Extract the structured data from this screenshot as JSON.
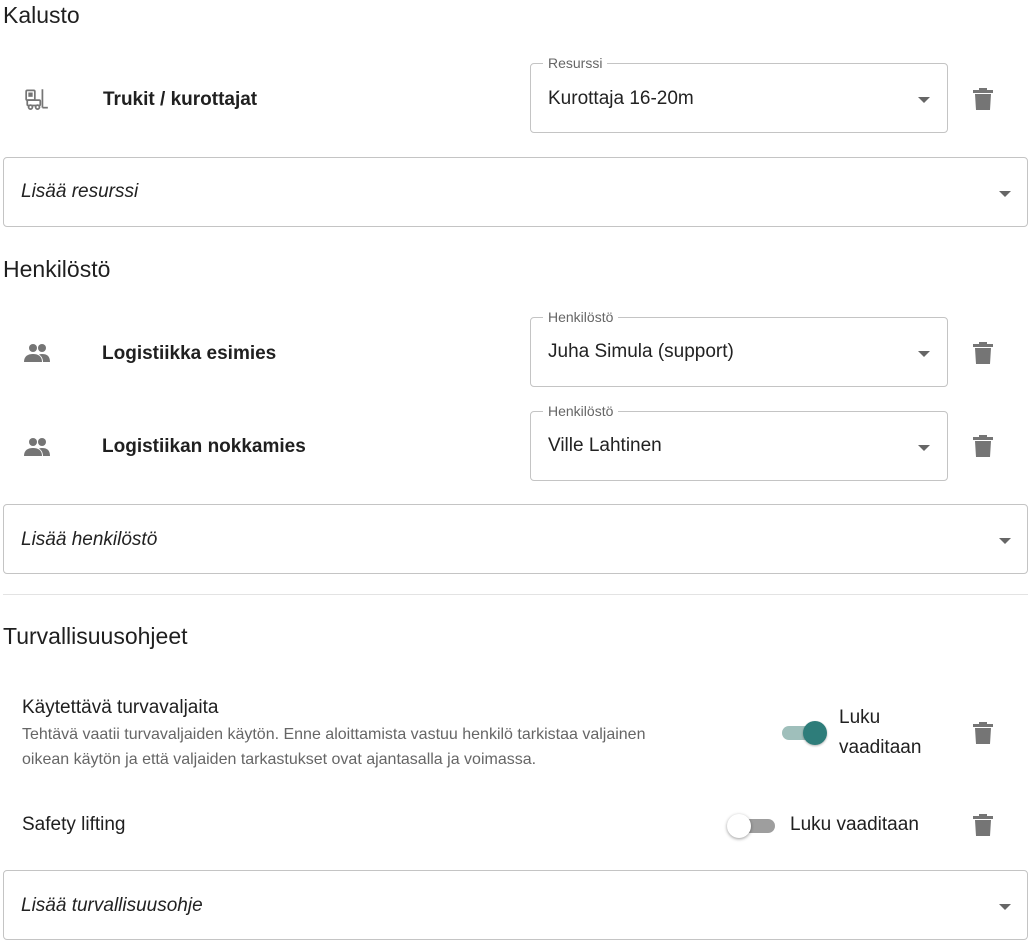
{
  "sections": {
    "equipment_title": "Kalusto",
    "personnel_title": "Henkilöstö",
    "safety_title": "Turvallisuusohjeet"
  },
  "equipment": {
    "rows": [
      {
        "label": "Trukit / kurottajat",
        "field_legend": "Resurssi",
        "field_value": "Kurottaja 16-20m",
        "icon": "forklift-icon"
      }
    ],
    "add_placeholder": "Lisää resurssi"
  },
  "personnel": {
    "rows": [
      {
        "label": "Logistiikka esimies",
        "field_legend": "Henkilöstö",
        "field_value": "Juha Simula (support)",
        "icon": "group-icon"
      },
      {
        "label": "Logistiikan nokkamies",
        "field_legend": "Henkilöstö",
        "field_value": "Ville Lahtinen",
        "icon": "group-icon"
      }
    ],
    "add_placeholder": "Lisää henkilöstö"
  },
  "safety": {
    "items": [
      {
        "title": "Käytettävä turvavaljaita",
        "description_line1": "Tehtävä vaatii turvavaljaiden käytön. Enne aloittamista vastuu henkilö tarkistaa valjainen",
        "description_line2": "oikean käytön ja että valjaiden tarkastukset ovat ajantasalla ja voimassa.",
        "toggle_label_line1": "Luku",
        "toggle_label_line2": "vaaditaan",
        "toggle_on": true
      },
      {
        "title": "Safety lifting",
        "toggle_label": "Luku vaaditaan",
        "toggle_on": false
      }
    ],
    "add_placeholder": "Lisää turvallisuusohje"
  },
  "colors": {
    "toggle_on_thumb": "#2e7d7a",
    "toggle_on_track": "#9fbfbb",
    "toggle_off_track": "#9e9e9e",
    "icon": "#757575"
  }
}
